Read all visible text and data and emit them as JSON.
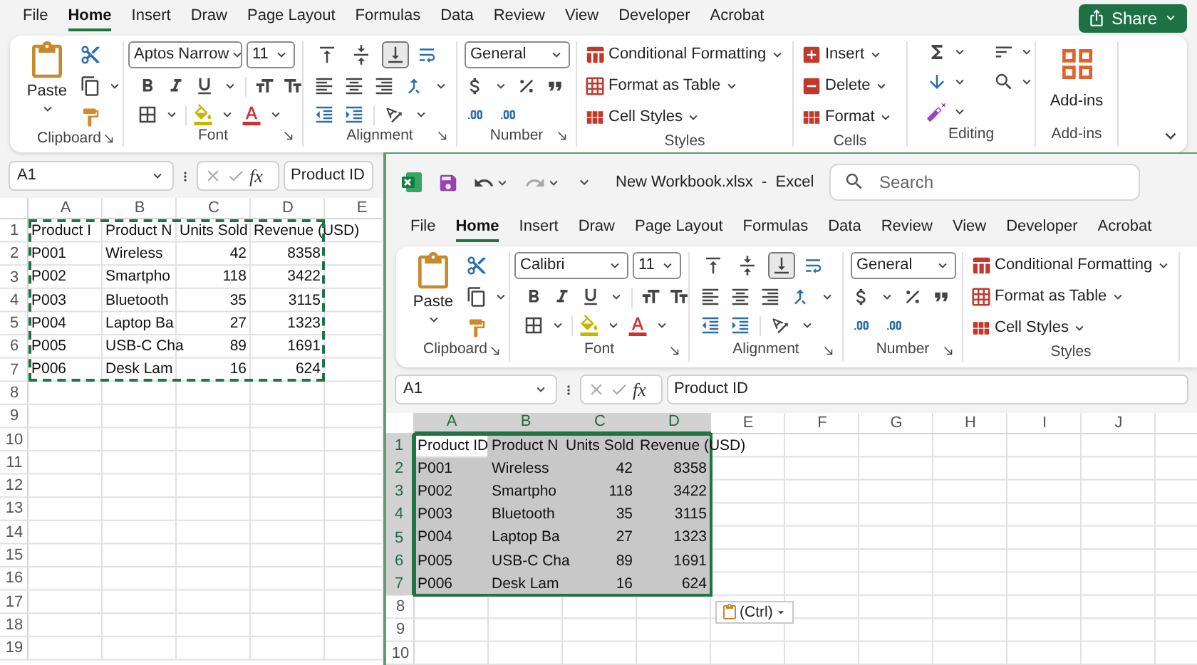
{
  "back_window": {
    "menu_tabs": [
      {
        "label": "File",
        "selected": false
      },
      {
        "label": "Home",
        "selected": true
      },
      {
        "label": "Insert",
        "selected": false
      },
      {
        "label": "Draw",
        "selected": false
      },
      {
        "label": "Page Layout",
        "selected": false
      },
      {
        "label": "Formulas",
        "selected": false
      },
      {
        "label": "Data",
        "selected": false
      },
      {
        "label": "Review",
        "selected": false
      },
      {
        "label": "View",
        "selected": false
      },
      {
        "label": "Developer",
        "selected": false
      },
      {
        "label": "Acrobat",
        "selected": false
      }
    ],
    "share_button": "Share",
    "ribbon": [
      {
        "kind": "clipboard",
        "label": "Clipboard",
        "paste": "Paste"
      },
      {
        "kind": "font",
        "label": "Font",
        "font_name": "Aptos Narrow",
        "font_size": "11"
      },
      {
        "kind": "alignment",
        "label": "Alignment",
        "vertical_align": [
          {
            "selected": false
          },
          {
            "selected": false
          },
          {
            "selected": true
          }
        ]
      },
      {
        "kind": "number",
        "label": "Number",
        "format": "General"
      },
      {
        "kind": "styles",
        "label": "Styles",
        "items": [
          "Conditional Formatting",
          "Format as Table",
          "Cell Styles"
        ]
      },
      {
        "kind": "cells",
        "label": "Cells",
        "items": [
          "Insert",
          "Delete",
          "Format"
        ]
      },
      {
        "kind": "editing",
        "label": "Editing"
      },
      {
        "kind": "addins",
        "label": "Add-ins",
        "button": "Add-ins"
      }
    ],
    "name_box": "A1",
    "insert_function": "fx",
    "formula": "Product ID",
    "grid": {
      "copy_marquee": true,
      "selection_highlight": false,
      "columns": [
        {
          "label": "A"
        },
        {
          "label": "B"
        },
        {
          "label": "C"
        },
        {
          "label": "D"
        },
        {
          "label": "E"
        }
      ],
      "rows": [
        {
          "number": "1",
          "cells": [
            {
              "text": "Product I",
              "numeric": false
            },
            {
              "text": "Product N",
              "numeric": false
            },
            {
              "text": "Units Sold",
              "numeric": false
            },
            {
              "text": "Revenue (USD)",
              "numeric": false
            }
          ]
        },
        {
          "number": "2",
          "cells": [
            {
              "text": "P001",
              "numeric": false
            },
            {
              "text": "Wireless",
              "numeric": false
            },
            {
              "text": "42",
              "numeric": true
            },
            {
              "text": "8358",
              "numeric": true
            }
          ]
        },
        {
          "number": "3",
          "cells": [
            {
              "text": "P002",
              "numeric": false
            },
            {
              "text": "Smartpho",
              "numeric": false
            },
            {
              "text": "118",
              "numeric": true
            },
            {
              "text": "3422",
              "numeric": true
            }
          ]
        },
        {
          "number": "4",
          "cells": [
            {
              "text": "P003",
              "numeric": false
            },
            {
              "text": "Bluetooth",
              "numeric": false
            },
            {
              "text": "35",
              "numeric": true
            },
            {
              "text": "3115",
              "numeric": true
            }
          ]
        },
        {
          "number": "5",
          "cells": [
            {
              "text": "P004",
              "numeric": false
            },
            {
              "text": "Laptop Ba",
              "numeric": false
            },
            {
              "text": "27",
              "numeric": true
            },
            {
              "text": "1323",
              "numeric": true
            }
          ]
        },
        {
          "number": "6",
          "cells": [
            {
              "text": "P005",
              "numeric": false
            },
            {
              "text": "USB-C Cha",
              "numeric": false
            },
            {
              "text": "89",
              "numeric": true
            },
            {
              "text": "1691",
              "numeric": true
            }
          ]
        },
        {
          "number": "7",
          "cells": [
            {
              "text": "P006",
              "numeric": false
            },
            {
              "text": "Desk Lam",
              "numeric": false
            },
            {
              "text": "16",
              "numeric": true
            },
            {
              "text": "624",
              "numeric": true
            }
          ]
        },
        {
          "number": "8"
        },
        {
          "number": "9"
        },
        {
          "number": "10"
        },
        {
          "number": "11"
        },
        {
          "number": "12"
        },
        {
          "number": "13"
        },
        {
          "number": "14"
        },
        {
          "number": "15"
        },
        {
          "number": "16"
        },
        {
          "number": "17"
        },
        {
          "number": "18"
        },
        {
          "number": "19"
        }
      ]
    }
  },
  "front_window": {
    "title": "New Workbook.xlsx  -  Excel",
    "search": {
      "placeholder": "Search"
    },
    "menu_tabs": [
      {
        "label": "File",
        "selected": false
      },
      {
        "label": "Home",
        "selected": true
      },
      {
        "label": "Insert",
        "selected": false
      },
      {
        "label": "Draw",
        "selected": false
      },
      {
        "label": "Page Layout",
        "selected": false
      },
      {
        "label": "Formulas",
        "selected": false
      },
      {
        "label": "Data",
        "selected": false
      },
      {
        "label": "Review",
        "selected": false
      },
      {
        "label": "View",
        "selected": false
      },
      {
        "label": "Developer",
        "selected": false
      },
      {
        "label": "Acrobat",
        "selected": false
      }
    ],
    "ribbon": [
      {
        "kind": "clipboard",
        "label": "Clipboard",
        "paste": "Paste"
      },
      {
        "kind": "font",
        "label": "Font",
        "font_name": "Calibri",
        "font_size": "11"
      },
      {
        "kind": "alignment",
        "label": "Alignment",
        "vertical_align": [
          {
            "selected": false
          },
          {
            "selected": false
          },
          {
            "selected": true
          }
        ]
      },
      {
        "kind": "number",
        "label": "Number",
        "format": "General"
      },
      {
        "kind": "styles",
        "label": "Styles",
        "items": [
          "Conditional Formatting",
          "Format as Table",
          "Cell Styles"
        ]
      }
    ],
    "name_box": "A1",
    "insert_function": "fx",
    "formula": "Product ID",
    "grid": {
      "copy_marquee": false,
      "selection_highlight": true,
      "columns": [
        {
          "label": "A"
        },
        {
          "label": "B"
        },
        {
          "label": "C"
        },
        {
          "label": "D"
        },
        {
          "label": "E"
        },
        {
          "label": "F"
        },
        {
          "label": "G"
        },
        {
          "label": "H"
        },
        {
          "label": "I"
        },
        {
          "label": "J"
        }
      ],
      "rows": [
        {
          "number": "1",
          "cells": [
            {
              "text": "Product ID",
              "numeric": false
            },
            {
              "text": "Product N",
              "numeric": false
            },
            {
              "text": "Units Sold",
              "numeric": false
            },
            {
              "text": "Revenue (USD)",
              "numeric": false
            }
          ]
        },
        {
          "number": "2",
          "cells": [
            {
              "text": "P001",
              "numeric": false
            },
            {
              "text": "Wireless",
              "numeric": false
            },
            {
              "text": "42",
              "numeric": true
            },
            {
              "text": "8358",
              "numeric": true
            }
          ]
        },
        {
          "number": "3",
          "cells": [
            {
              "text": "P002",
              "numeric": false
            },
            {
              "text": "Smartpho",
              "numeric": false
            },
            {
              "text": "118",
              "numeric": true
            },
            {
              "text": "3422",
              "numeric": true
            }
          ]
        },
        {
          "number": "4",
          "cells": [
            {
              "text": "P003",
              "numeric": false
            },
            {
              "text": "Bluetooth",
              "numeric": false
            },
            {
              "text": "35",
              "numeric": true
            },
            {
              "text": "3115",
              "numeric": true
            }
          ]
        },
        {
          "number": "5",
          "cells": [
            {
              "text": "P004",
              "numeric": false
            },
            {
              "text": "Laptop Ba",
              "numeric": false
            },
            {
              "text": "27",
              "numeric": true
            },
            {
              "text": "1323",
              "numeric": true
            }
          ]
        },
        {
          "number": "6",
          "cells": [
            {
              "text": "P005",
              "numeric": false
            },
            {
              "text": "USB-C Cha",
              "numeric": false
            },
            {
              "text": "89",
              "numeric": true
            },
            {
              "text": "1691",
              "numeric": true
            }
          ]
        },
        {
          "number": "7",
          "cells": [
            {
              "text": "P006",
              "numeric": false
            },
            {
              "text": "Desk Lam",
              "numeric": false
            },
            {
              "text": "16",
              "numeric": true
            },
            {
              "text": "624",
              "numeric": true
            }
          ]
        },
        {
          "number": "8"
        },
        {
          "number": "9"
        },
        {
          "number": "10"
        }
      ]
    },
    "paste_options": "(Ctrl)"
  }
}
